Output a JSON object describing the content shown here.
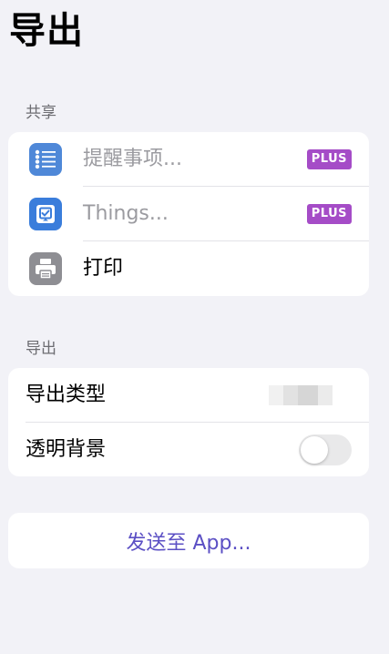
{
  "page": {
    "title": "导出"
  },
  "share_section": {
    "header": "共享",
    "items": [
      {
        "label": "提醒事项...",
        "badge": "PLUS",
        "icon": "reminders-list-icon",
        "icon_color": "#4f88d8"
      },
      {
        "label": "Things...",
        "badge": "PLUS",
        "icon": "things-checkbox-icon",
        "icon_color": "#3a7ddb"
      },
      {
        "label": "打印",
        "icon": "printer-icon",
        "icon_color": "#8e8e93"
      }
    ]
  },
  "export_section": {
    "header": "导出",
    "export_type_label": "导出类型",
    "transparent_bg_label": "透明背景",
    "transparent_bg_enabled": false
  },
  "send_to_app": {
    "label": "发送至 App..."
  },
  "colors": {
    "background": "#f2f2f7",
    "plus_badge": "#a54cc7",
    "accent_text": "#5b4fc4"
  }
}
